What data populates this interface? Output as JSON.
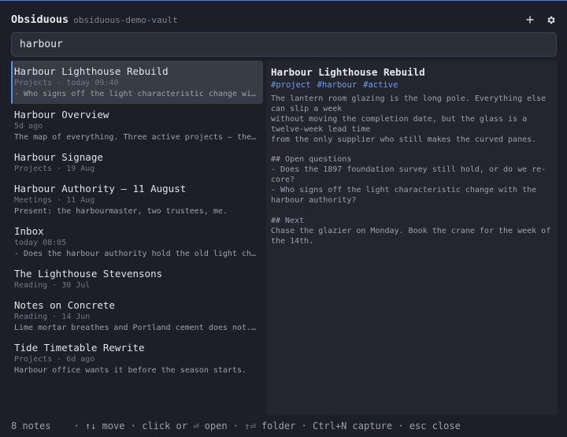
{
  "header": {
    "app_name": "Obsiduous",
    "vault_name": "obsiduous-demo-vault",
    "actions": [
      {
        "name": "add-note",
        "icon": "plus-icon"
      },
      {
        "name": "settings",
        "icon": "gear-icon"
      }
    ]
  },
  "search": {
    "value": "harbour",
    "placeholder": ""
  },
  "results": [
    {
      "title": "Harbour Lighthouse Rebuild",
      "folder": "Projects",
      "time": "today 09:40",
      "snippet": "- Who signs off the light characteristic change with the harbour authority?",
      "selected": true
    },
    {
      "title": "Harbour Overview",
      "folder": "",
      "time": "5d ago",
      "snippet": "The map of everything. Three active projects — the [[Harbour Lighthouse Rebuild]]",
      "selected": false
    },
    {
      "title": "Harbour Signage",
      "folder": "Projects",
      "time": "19 Aug",
      "snippet": "",
      "selected": false
    },
    {
      "title": "Harbour Authority — 11 August",
      "folder": "Meetings",
      "time": "11 Aug",
      "snippet": "Present: the harbourmaster, two trustees, me.",
      "selected": false
    },
    {
      "title": "Inbox",
      "folder": "",
      "time": "today 08:05",
      "snippet": "- Does the harbour authority hold the old light characteristic records?",
      "selected": false
    },
    {
      "title": "The Lighthouse Stevensons",
      "folder": "Reading",
      "time": "30 Jul",
      "snippet": "",
      "selected": false
    },
    {
      "title": "Notes on Concrete",
      "folder": "Reading",
      "time": "14 Jun",
      "snippet": "Lime mortar breathes and Portland cement does not. On old masonry",
      "selected": false
    },
    {
      "title": "Tide Timetable Rewrite",
      "folder": "Projects",
      "time": "6d ago",
      "snippet": "Harbour office wants it before the season starts.",
      "selected": false
    }
  ],
  "preview": {
    "title": "Harbour Lighthouse Rebuild",
    "tags": [
      "#project",
      "#harbour",
      "#active"
    ],
    "body": "The lantern room glazing is the long pole. Everything else can slip a week\nwithout moving the completion date, but the glass is a twelve-week lead time\nfrom the only supplier who still makes the curved panes.\n\n## Open questions\n- Does the 1897 foundation survey still hold, or do we re-core?\n- Who signs off the light characteristic change with the harbour authority?\n\n## Next\nChase the glazier on Monday. Book the crane for the week of the 14th."
  },
  "footer": {
    "count": "8 notes",
    "hints": [
      "↑↓ move",
      "click or ⏎ open",
      "⇧⏎ folder",
      "Ctrl+N capture",
      "esc close"
    ],
    "separator": "·"
  },
  "colors": {
    "background": "#1c1f27",
    "accent": "#5b8fe0",
    "tag": "#6b9cf0",
    "selected_row": "#383c47"
  }
}
